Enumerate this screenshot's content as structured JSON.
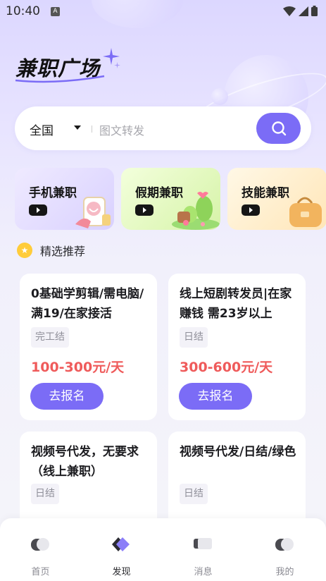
{
  "status_bar": {
    "time": "10:40",
    "indicator": "A"
  },
  "header": {
    "title": "兼职广场"
  },
  "search": {
    "region": "全国",
    "placeholder": "图文转发"
  },
  "categories": [
    {
      "label": "手机兼职",
      "icon": "phone-hand-icon",
      "color": "#e3ddff"
    },
    {
      "label": "假期兼职",
      "icon": "island-icon",
      "color": "#e7f8cc"
    },
    {
      "label": "技能兼职",
      "icon": "bag-icon",
      "color": "#fff1d2"
    }
  ],
  "section": {
    "title": "精选推荐"
  },
  "jobs": [
    {
      "title": "0基础学剪辑/需电脑/满19/在家接活",
      "tag": "完工结",
      "price": "100-300元/天",
      "apply": "去报名"
    },
    {
      "title": "线上短剧转发员|在家赚钱 需23岁以上",
      "tag": "日结",
      "price": "300-600元/天",
      "apply": "去报名"
    },
    {
      "title": "视频号代发，无要求（线上兼职）",
      "tag": "日结"
    },
    {
      "title": "视频号代发/日结/绿色",
      "tag": "日结"
    }
  ],
  "tabs": [
    {
      "label": "首页",
      "icon": "home-icon"
    },
    {
      "label": "发现",
      "icon": "discover-icon",
      "active": true
    },
    {
      "label": "消息",
      "icon": "message-icon"
    },
    {
      "label": "我的",
      "icon": "profile-icon"
    }
  ],
  "colors": {
    "accent": "#7b6cf6",
    "price": "#ef5b5b"
  }
}
